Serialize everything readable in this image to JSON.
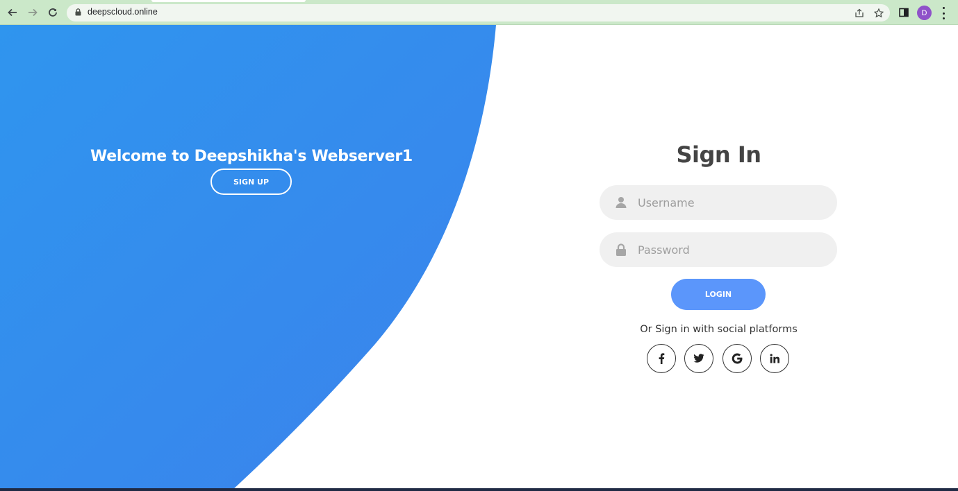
{
  "browser": {
    "url": "deepscloud.online",
    "profile_initial": "D",
    "icons": [
      "back-arrow-icon",
      "forward-arrow-icon",
      "reload-icon",
      "lock-icon",
      "share-icon",
      "star-icon",
      "side-panel-icon",
      "kebab-menu-icon"
    ]
  },
  "hero": {
    "welcome_text": "Welcome to Deepshikha's Webserver1",
    "signup_label": "SIGN UP"
  },
  "signin": {
    "title": "Sign In",
    "username_placeholder": "Username",
    "password_placeholder": "Password",
    "login_label": "LOGIN",
    "social_text": "Or Sign in with social platforms",
    "social": [
      {
        "icon": "facebook-icon",
        "glyph": "f"
      },
      {
        "icon": "twitter-icon",
        "glyph": ""
      },
      {
        "icon": "google-icon",
        "glyph": "G"
      },
      {
        "icon": "linkedin-icon",
        "glyph": "in"
      }
    ]
  },
  "colors": {
    "accent_blue": "#3a8af0",
    "login_button": "#5b96fb",
    "chrome_green": "#cbe8c9",
    "avatar_purple": "#8f52c9"
  }
}
